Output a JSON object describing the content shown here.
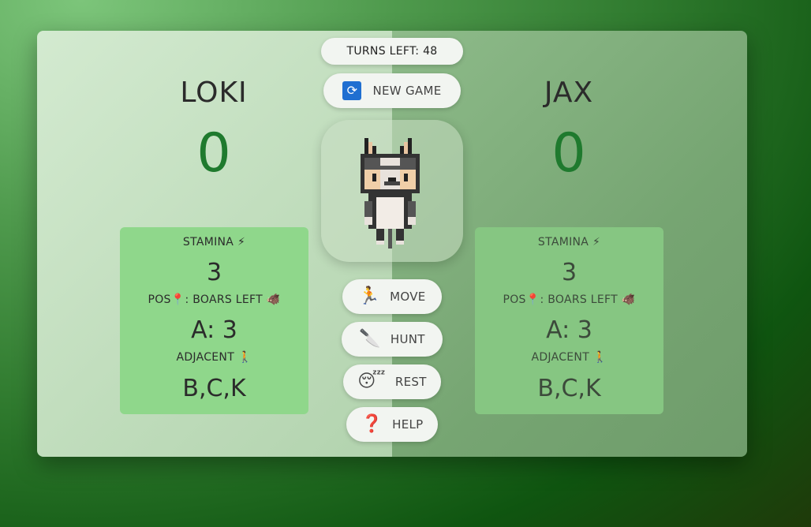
{
  "turns_left": "TURNS LEFT: 48",
  "new_game": {
    "label": "NEW GAME",
    "icon": "refresh-icon"
  },
  "players": [
    {
      "name": "LOKI",
      "score": "0",
      "stamina_label": "STAMINA",
      "stamina": "3",
      "pos_label_a": "POS",
      "pos_label_b": ": BOARS LEFT",
      "position_value": "A: 3",
      "adjacent_label": "ADJACENT",
      "adjacent_value": "B,C,K"
    },
    {
      "name": "JAX",
      "score": "0",
      "stamina_label": "STAMINA",
      "stamina": "3",
      "pos_label_a": "POS",
      "pos_label_b": ": BOARS LEFT",
      "position_value": "A: 3",
      "adjacent_label": "ADJACENT",
      "adjacent_value": "B,C,K"
    }
  ],
  "actions": [
    {
      "label": "MOVE",
      "icon": "runner-icon"
    },
    {
      "label": "HUNT",
      "icon": "knife-icon"
    },
    {
      "label": "REST",
      "icon": "sleepy-face-icon"
    },
    {
      "label": "HELP",
      "icon": "question-mark-icon"
    }
  ],
  "colors": {
    "score": "#1f7a2e",
    "left_stats_bg": "#8fd78b",
    "right_stats_bg": "#86c682",
    "refresh_icon_bg": "#1f6fd1"
  }
}
